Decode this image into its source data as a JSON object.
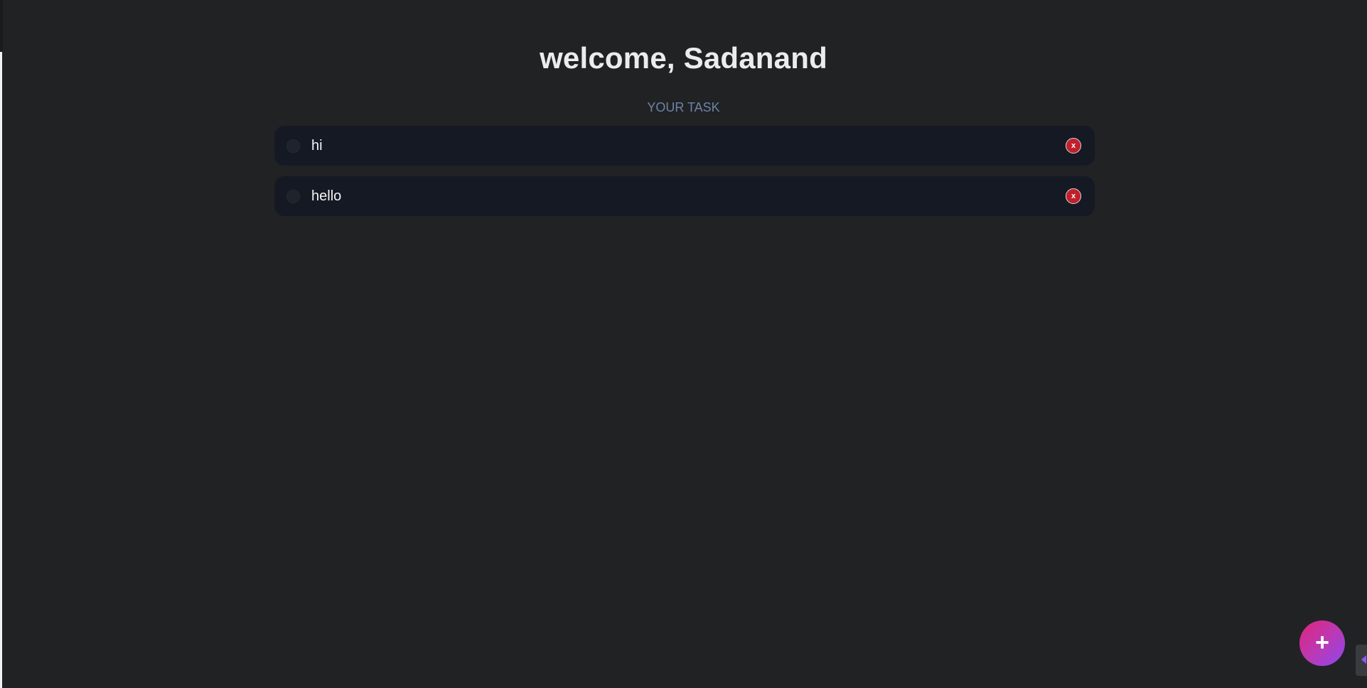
{
  "header": {
    "title": "welcome, Sadanand",
    "subtitle": "YOUR TASK"
  },
  "tasks": [
    {
      "text": "hi",
      "completed": false,
      "delete_label": "x"
    },
    {
      "text": "hello",
      "completed": false,
      "delete_label": "x"
    }
  ],
  "fab": {
    "label": "+",
    "icon": "plus-icon"
  },
  "colors": {
    "background": "#212224",
    "card": "#151924",
    "subtitle": "#6d83a6",
    "delete": "#c0202b",
    "fab_gradient_start": "#e0247a",
    "fab_gradient_end": "#8b47f0"
  }
}
